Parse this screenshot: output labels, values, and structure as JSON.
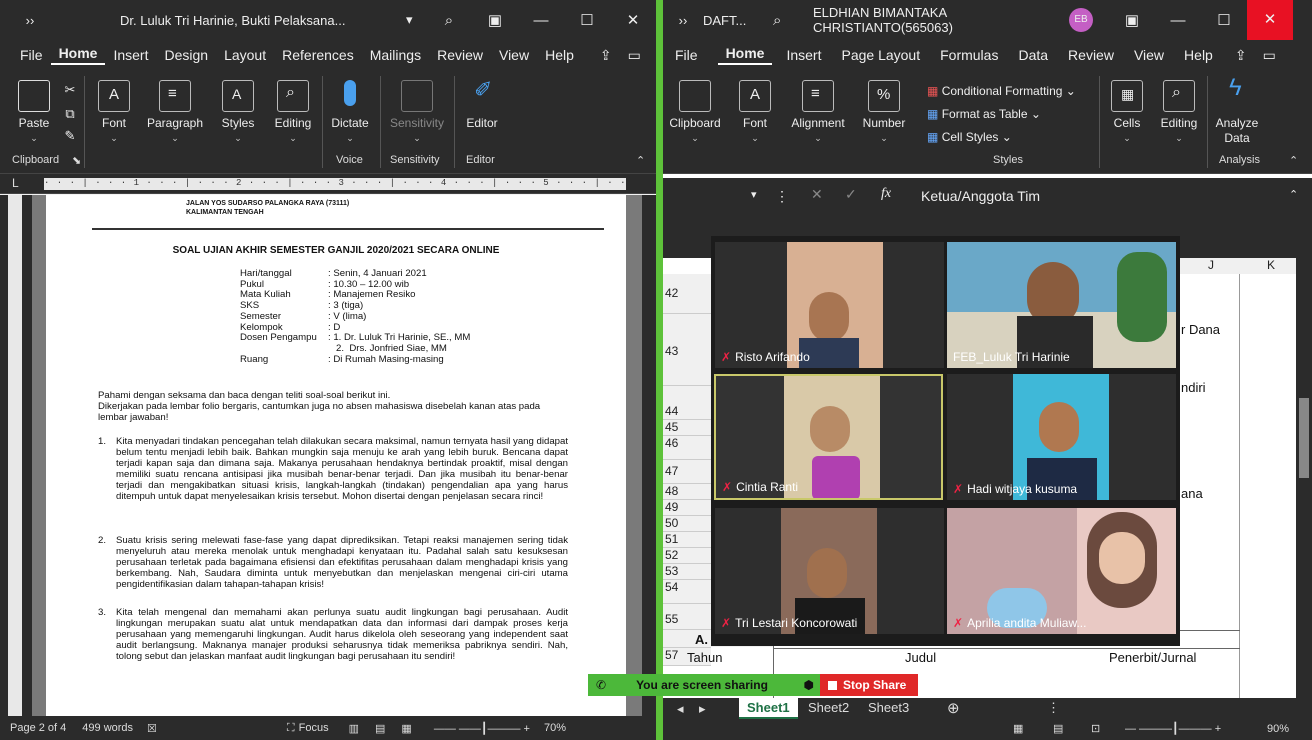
{
  "word": {
    "title": "Dr. Luluk Tri Harinie, Bukti Pelaksana...",
    "menu": [
      "File",
      "Home",
      "Insert",
      "Design",
      "Layout",
      "References",
      "Mailings",
      "Review",
      "View",
      "Help"
    ],
    "ribbon": {
      "paste": "Paste",
      "font": "Font",
      "paragraph": "Paragraph",
      "styles": "Styles",
      "editing": "Editing",
      "dictate": "Dictate",
      "sensitivity": "Sensitivity",
      "editor": "Editor",
      "groups": {
        "clipboard": "Clipboard",
        "voice": "Voice",
        "sensitivity": "Sensitivity",
        "editor": "Editor"
      }
    },
    "ruler": "· · · | · · · 1 · · · | · · · 2 · · · | · · · 3 · · · | · · · 4 · · · | · · · 5 · · · | · · · 6 · · · | · · · 7 · · ·",
    "doc": {
      "addr1": "JALAN YOS SUDARSO PALANGKA RAYA (73111)",
      "addr2": "KALIMANTAN TENGAH",
      "heading": "SOAL UJIAN AKHIR SEMESTER GANJIL 2020/2021 SECARA ONLINE",
      "info": [
        {
          "k": "Hari/tanggal",
          "v": ": Senin, 4 Januari 2021"
        },
        {
          "k": "Pukul",
          "v": ": 10.30 – 12.00 wib"
        },
        {
          "k": "Mata Kuliah",
          "v": ": Manajemen Resiko"
        },
        {
          "k": "SKS",
          "v": ": 3 (tiga)"
        },
        {
          "k": "Semester",
          "v": ": V (lima)"
        },
        {
          "k": "Kelompok",
          "v": ": D"
        },
        {
          "k": "Dosen Pengampu",
          "v": ": 1.  Dr. Luluk Tri Harinie, SE., MM"
        },
        {
          "k": "",
          "v": "   2.  Drs. Jonfried Siae, MM"
        },
        {
          "k": "Ruang",
          "v": ": Di Rumah Masing-masing"
        }
      ],
      "intro1": "Pahami dengan seksama dan baca dengan teliti soal-soal berikut ini.",
      "intro2": "Dikerjakan pada lembar folio bergaris, cantumkan juga no absen mahasiswa disebelah kanan atas pada lembar jawaban!",
      "q1": "Kita menyadari tindakan pencegahan telah dilakukan secara maksimal, namun ternyata hasil yang didapat belum tentu menjadi lebih baik. Bahkan mungkin saja menuju ke arah yang lebih buruk. Bencana dapat terjadi kapan saja dan dimana saja. Makanya perusahaan hendaknya bertindak proaktif, misal dengan memiliki suatu rencana antisipasi jika musibah benar-benar terjadi. Dan jika musibah itu benar-benar terjadi dan mengakibatkan situasi krisis, langkah-langkah (tindakan) pengendalian apa yang harus ditempuh untuk dapat menyelesaikan krisis tersebut. Mohon disertai dengan penjelasan secara rinci!",
      "q2": "Suatu krisis sering melewati fase-fase yang dapat diprediksikan. Tetapi reaksi manajemen sering tidak menyeluruh atau mereka menolak untuk menghadapi kenyataan itu. Padahal salah satu kesuksesan perusahaan terletak pada bagaimana efisiensi dan efektifitas perusahaan dalam menghadapi krisis yang berkembang. Nah, Saudara diminta untuk menyebutkan dan menjelaskan mengenai ciri-ciri utama pengidentifikasian dalam tahapan-tahapan krisis!",
      "q3": "Kita telah mengenal dan memahami akan perlunya suatu audit lingkungan bagi perusahaan. Audit lingkungan merupakan suatu alat untuk mendapatkan data dan informasi dari dampak proses kerja perusahaan yang memengaruhi lingkungan. Audit harus dikelola oleh seseorang yang independent saat audit berlangsung. Maknanya manajer produksi seharusnya tidak memeriksa pabriknya sendiri. Nah, tolong sebut dan jelaskan manfaat audit lingkungan bagi perusahaan itu sendiri!"
    },
    "status": {
      "page": "Page 2 of 4",
      "words": "499 words",
      "focus": "Focus",
      "zoom": "70%"
    }
  },
  "excel": {
    "title": "DAFT...",
    "user": "ELDHIAN BIMANTAKA CHRISTIANTO(565063)",
    "avatar": "EB",
    "menu": [
      "File",
      "Home",
      "Insert",
      "Page Layout",
      "Formulas",
      "Data",
      "Review",
      "View",
      "Help"
    ],
    "ribbon": {
      "clipboard": "Clipboard",
      "font": "Font",
      "alignment": "Alignment",
      "number": "Number",
      "cond": "Conditional Formatting",
      "table": "Format as Table",
      "cellstyles": "Cell Styles",
      "styles_group": "Styles",
      "cells": "Cells",
      "editing": "Editing",
      "analyze1": "Analyze",
      "analyze2": "Data",
      "analysis_group": "Analysis"
    },
    "formula": "Ketua/Anggota Tim",
    "fx": "fx",
    "cols": [
      "J",
      "K"
    ],
    "rows": [
      "42",
      "43",
      "44",
      "45",
      "46",
      "47",
      "48",
      "49",
      "50",
      "51",
      "52",
      "53",
      "54",
      "55",
      "56",
      "57"
    ],
    "cells": {
      "r42": "r Dana",
      "r43": "ndiri",
      "r48": "ana",
      "r56": "A. B",
      "r57a": "Tahun",
      "r57b": "Judul",
      "r57c": "Penerbit/Jurnal"
    },
    "sheets": [
      "Sheet1",
      "Sheet2",
      "Sheet3"
    ],
    "zoom": "90%"
  },
  "meeting": {
    "participants": [
      "Risto Arifando",
      "FEB_Luluk Tri Harinie",
      "Cintia Ranti",
      "Hadi witjaya kusuma",
      "Tri Lestari Koncorowati",
      "Aprilia andita Muliaw..."
    ],
    "sharing": "You are screen sharing",
    "stop": "Stop Share"
  }
}
